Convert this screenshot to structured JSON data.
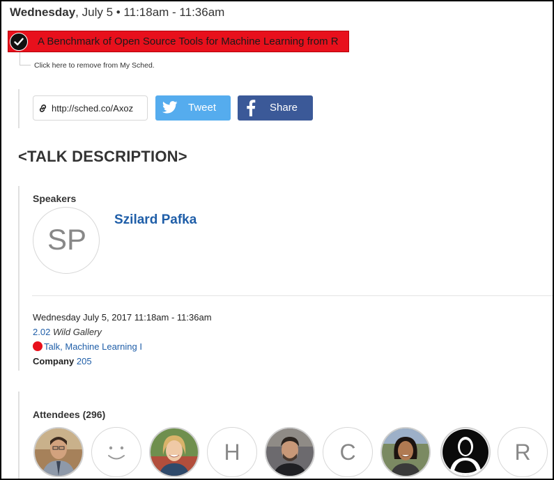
{
  "session": {
    "day_name": "Wednesday",
    "date_time": ", July 5 • 11:18am - 11:36am",
    "title": "A Benchmark of Open Source Tools for Machine Learning from R",
    "remove_text": "Click here to remove from My Sched."
  },
  "share": {
    "url": "http://sched.co/Axoz",
    "tweet_label": "Tweet",
    "share_label": "Share"
  },
  "description_heading": "<TALK DESCRIPTION>",
  "speakers": {
    "label": "Speakers",
    "items": [
      {
        "initials": "SP",
        "name": "Szilard Pafka"
      }
    ]
  },
  "details": {
    "datetime": "Wednesday July 5, 2017 11:18am - 11:36am",
    "room_number": "2.02",
    "room_name": "Wild Gallery",
    "type_talk": "Talk",
    "type_sep": ", ",
    "type_track": "Machine Learning I",
    "company_label": "Company",
    "company_value": "205"
  },
  "attendees": {
    "label": "Attendees (296)",
    "items": [
      {
        "kind": "photo"
      },
      {
        "kind": "smiley"
      },
      {
        "kind": "photo"
      },
      {
        "kind": "initial",
        "initial": "H"
      },
      {
        "kind": "photo"
      },
      {
        "kind": "initial",
        "initial": "C"
      },
      {
        "kind": "photo"
      },
      {
        "kind": "silhouette"
      },
      {
        "kind": "initial",
        "initial": "R"
      }
    ]
  },
  "colors": {
    "accent_red": "#e8101c",
    "link_blue": "#1f5ea8",
    "twitter_blue": "#55acee",
    "facebook_blue": "#3b5998"
  }
}
